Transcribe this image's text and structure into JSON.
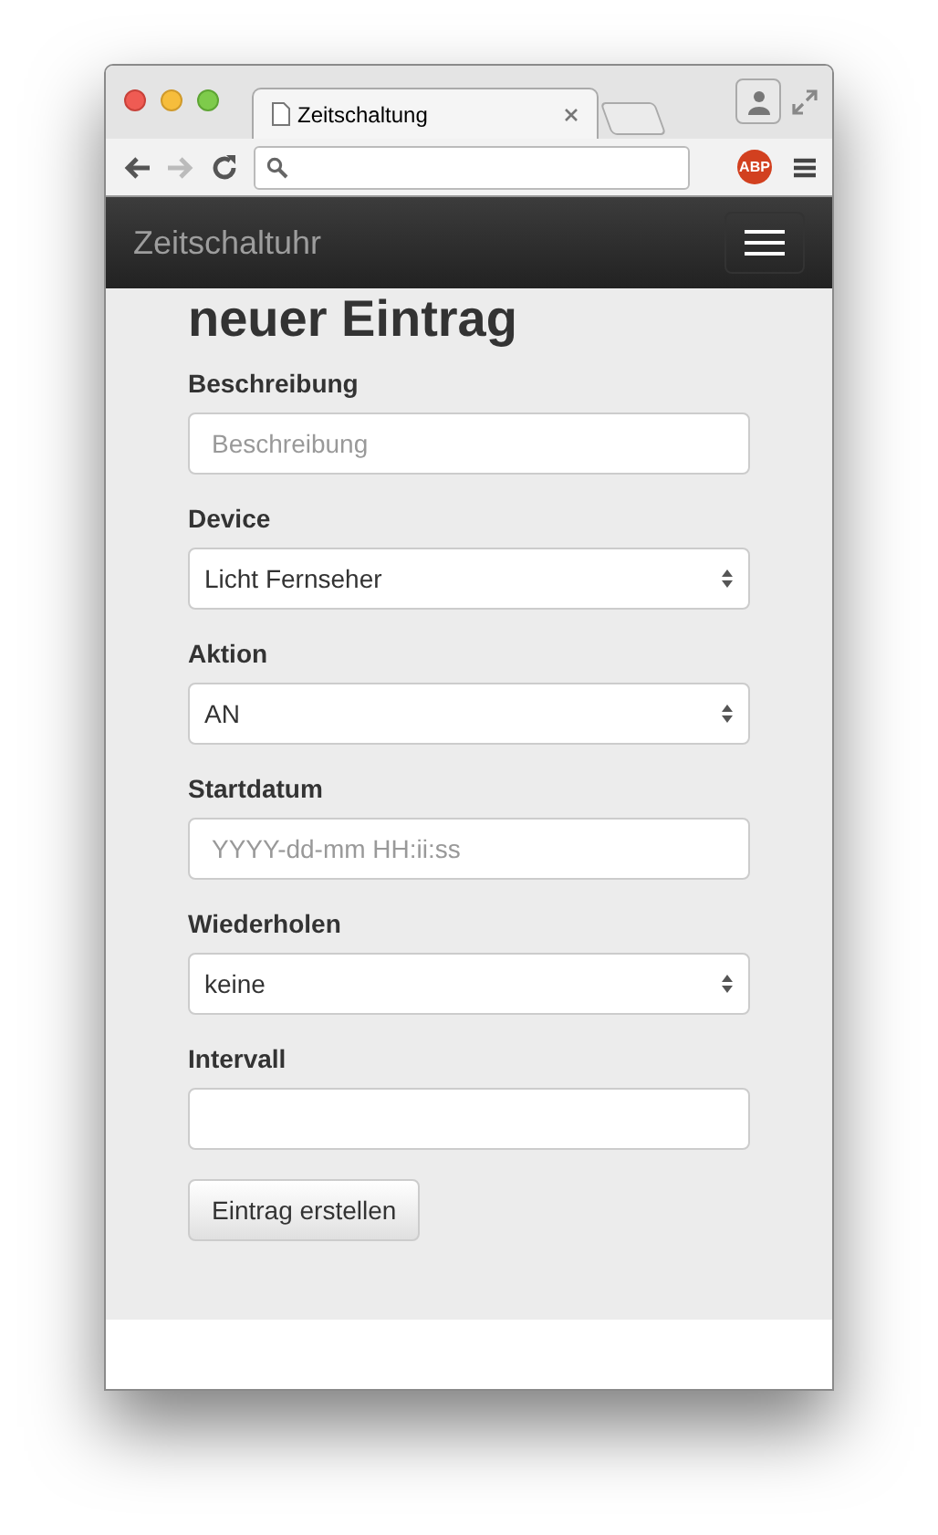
{
  "tab": {
    "title": "Zeitschaltung"
  },
  "navigation": {
    "forward_enabled": false
  },
  "extension_badge": "ABP",
  "navbar": {
    "brand": "Zeitschaltuhr"
  },
  "heading": "neuer Eintrag",
  "fields": [
    {
      "label": "Beschreibung",
      "kind": "text",
      "placeholder": "Beschreibung"
    },
    {
      "label": "Device",
      "kind": "select",
      "value": "Licht Fernseher"
    },
    {
      "label": "Aktion",
      "kind": "select",
      "value": "AN"
    },
    {
      "label": "Startdatum",
      "kind": "text",
      "placeholder": "YYYY-dd-mm HH:ii:ss"
    },
    {
      "label": "Wiederholen",
      "kind": "select",
      "value": "keine"
    },
    {
      "label": "Intervall",
      "kind": "text"
    }
  ],
  "submit": "Eintrag erstellen"
}
